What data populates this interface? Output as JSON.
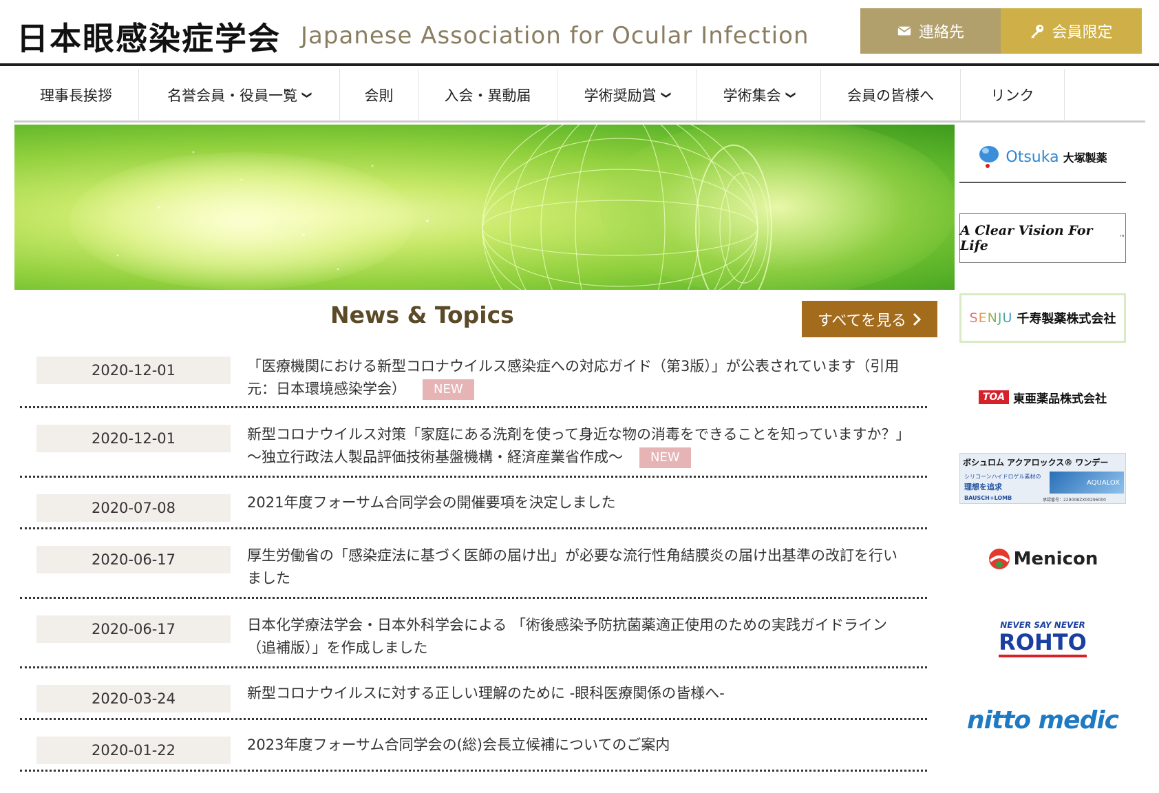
{
  "header": {
    "title": "日本眼感染症学会",
    "subtitle": "Japanese Association for Ocular Infection",
    "contact_label": "連絡先",
    "members_label": "会員限定"
  },
  "nav": {
    "items": [
      {
        "label": "理事長挨拶",
        "dropdown": false
      },
      {
        "label": "名誉会員・役員一覧",
        "dropdown": true
      },
      {
        "label": "会則",
        "dropdown": false
      },
      {
        "label": "入会・異動届",
        "dropdown": false
      },
      {
        "label": "学術奨励賞",
        "dropdown": true
      },
      {
        "label": "学術集会",
        "dropdown": true
      },
      {
        "label": "会員の皆様へ",
        "dropdown": false
      },
      {
        "label": "リンク",
        "dropdown": false
      }
    ],
    "chevron_glyph": "❯"
  },
  "news": {
    "title": "News & Topics",
    "see_all_label": "すべてを見る",
    "new_label": "NEW",
    "items": [
      {
        "date": "2020-12-01",
        "text": "「医療機関における新型コロナウイルス感染症への対応ガイド（第3版）」が公表されています（引用元：日本環境感染学会）",
        "is_new": true
      },
      {
        "date": "2020-12-01",
        "text": "新型コロナウイルス対策「家庭にある洗剤を使って身近な物の消毒をできることを知っていますか？」　～独立行政法人製品評価技術基盤機構・経済産業省作成～",
        "is_new": true
      },
      {
        "date": "2020-07-08",
        "text": "2021年度フォーサム合同学会の開催要項を決定しました",
        "is_new": false
      },
      {
        "date": "2020-06-17",
        "text": "厚生労働省の「感染症法に基づく医師の届け出」が必要な流行性角結膜炎の届け出基準の改訂を行いました",
        "is_new": false
      },
      {
        "date": "2020-06-17",
        "text": "日本化学療法学会・日本外科学会による 「術後感染予防抗菌薬適正使用のための実践ガイドライン（追補版）」を作成しました",
        "is_new": false
      },
      {
        "date": "2020-03-24",
        "text": "新型コロナウイルスに対する正しい理解のために -眼科医療関係の皆様へ-",
        "is_new": false
      },
      {
        "date": "2020-01-22",
        "text": "2023年度フォーサム合同学会の(総)会長立候補についてのご案内",
        "is_new": false
      }
    ]
  },
  "sponsors": {
    "otsuka": {
      "en": "Otsuka",
      "ja": "大塚製薬"
    },
    "jnj": {
      "text": "A Clear Vision For Life",
      "tm": "™"
    },
    "senju": {
      "en": "SENJU",
      "ja": "千寿製薬株式会社"
    },
    "toa": {
      "mark": "TOA",
      "ja": "東亜薬品株式会社"
    },
    "bausch": {
      "headline": "ボシュロム アクアロックス® ワンデー",
      "sub1": "シリコーンハイドロゲル素材の",
      "sub2": "理想を追求",
      "brand": "BAUSCH+LOMB",
      "product": "AQUALOX",
      "approval": "承認番号：22900BZX00296000"
    },
    "menicon": {
      "text": "Menicon"
    },
    "rohto": {
      "tagline": "NEVER SAY NEVER",
      "text": "ROHTO"
    },
    "nitto": {
      "text": "nitto medic"
    }
  },
  "colors": {
    "contact_bg": "#b1a06b",
    "members_bg": "#cfb048",
    "see_all_bg": "#a36b1c",
    "new_badge": "#e7b4b6",
    "date_bg": "#f2eeea",
    "news_title": "#5b4a27"
  },
  "icons": {
    "contact": "envelope-icon",
    "members": "key-icon",
    "see_all": "chevron-right-icon"
  }
}
